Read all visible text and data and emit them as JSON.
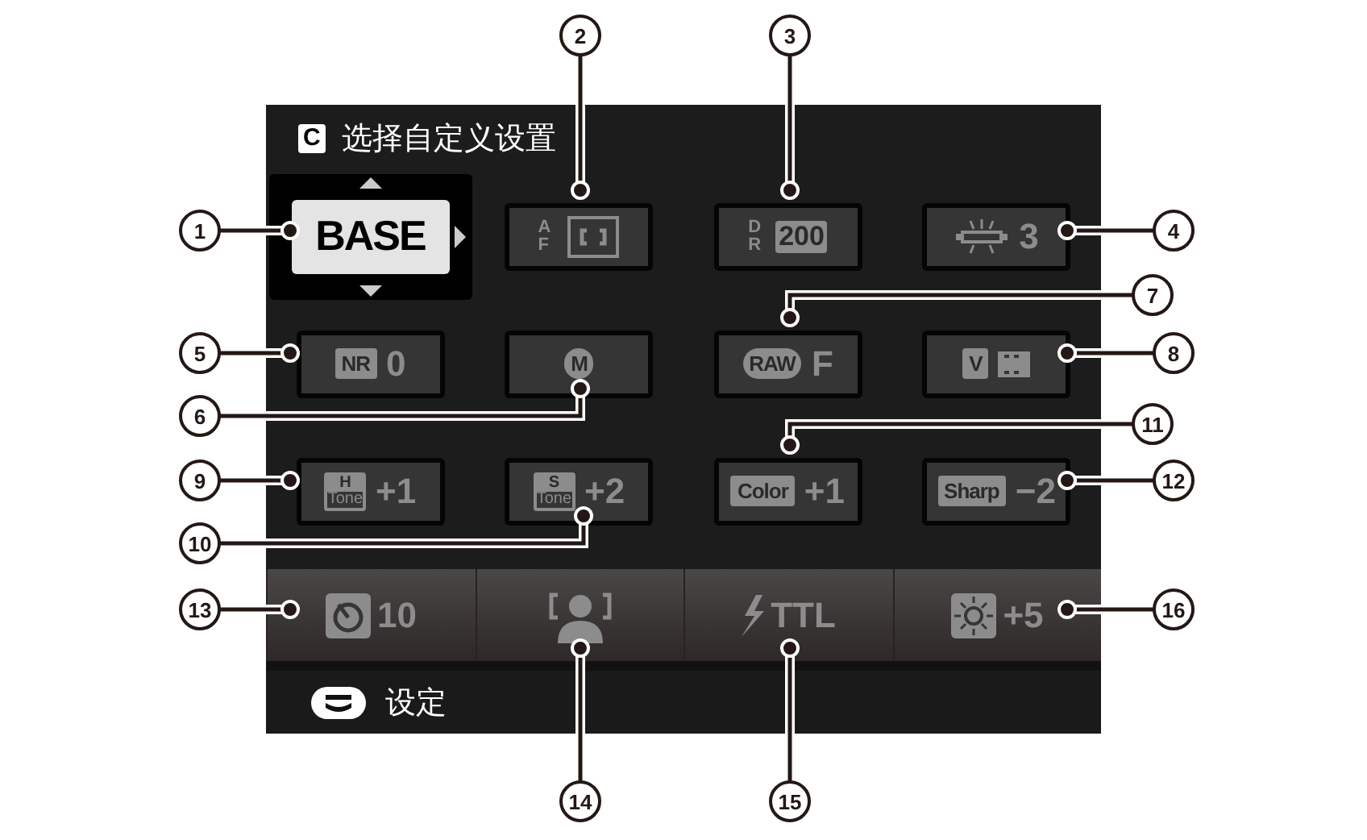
{
  "screen": {
    "title": "选择自定义设置",
    "title_icon": "C",
    "footer": "设定"
  },
  "cells": [
    {
      "kind": "label",
      "value": "BASE",
      "selected": true
    },
    {
      "kind": "af",
      "badge": "AF",
      "selected": false
    },
    {
      "kind": "dr",
      "badge": "DR",
      "value": "200",
      "selected": false
    },
    {
      "kind": "lamp",
      "value": "3",
      "selected": false
    },
    {
      "kind": "badge",
      "badge": "NR",
      "value": "0",
      "selected": false
    },
    {
      "kind": "lens",
      "badge": "M",
      "selected": false
    },
    {
      "kind": "lens",
      "badge": "RAW",
      "value": "F",
      "selected": false
    },
    {
      "kind": "film",
      "badge": "V",
      "selected": false
    },
    {
      "kind": "tone",
      "badge_top": "H",
      "badge": "Tone",
      "value": "+1",
      "selected": false
    },
    {
      "kind": "tone",
      "badge_top": "S",
      "badge": "Tone",
      "value": "+2",
      "selected": false
    },
    {
      "kind": "badge",
      "badge": "Color",
      "value": "+1",
      "selected": false
    },
    {
      "kind": "badge",
      "badge": "Sharp",
      "value": "−2",
      "selected": false
    }
  ],
  "strip": [
    {
      "kind": "timer",
      "value": "10"
    },
    {
      "kind": "face"
    },
    {
      "kind": "flash",
      "value": "TTL"
    },
    {
      "kind": "sun",
      "value": "+5"
    }
  ],
  "callouts": [
    "1",
    "2",
    "3",
    "4",
    "5",
    "6",
    "7",
    "8",
    "9",
    "10",
    "11",
    "12",
    "13",
    "14",
    "15",
    "16"
  ]
}
